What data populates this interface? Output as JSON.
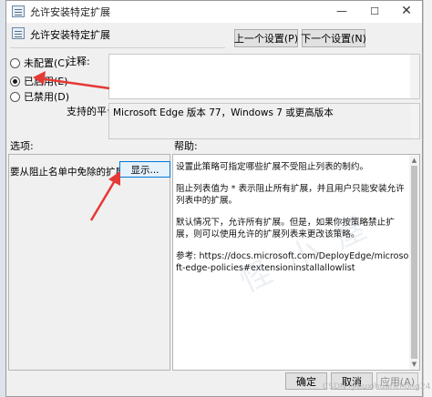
{
  "window": {
    "title": "允许安装特定扩展",
    "minimize_glyph": "—",
    "maximize_glyph": "☐",
    "close_glyph": "✕"
  },
  "header": {
    "title": "允许安装特定扩展",
    "prev_setting": "上一个设置(P)",
    "next_setting": "下一个设置(N)"
  },
  "state": {
    "options": [
      {
        "label": "未配置(C)",
        "checked": false
      },
      {
        "label": "已启用(E)",
        "checked": true
      },
      {
        "label": "已禁用(D)",
        "checked": false
      }
    ]
  },
  "fields": {
    "comment_label": "注释:",
    "comment_value": "",
    "supported_label": "支持的平台:",
    "supported_value": "Microsoft Edge 版本 77，Windows 7 或更高版本"
  },
  "sections": {
    "options_label": "选项:",
    "help_label": "帮助:"
  },
  "options_panel": {
    "exempt_label": "要从阻止名单中免除的扩展 ID",
    "show_button": "显示..."
  },
  "help": {
    "paragraphs": [
      "设置此策略可指定哪些扩展不受阻止列表的制约。",
      "阻止列表值为 * 表示阻止所有扩展，并且用户只能安装允许列表中的扩展。",
      "默认情况下，允许所有扩展。但是，如果你按策略禁止扩展，则可以使用允许的扩展列表来更改该策略。",
      "参考: https://docs.microsoft.com/DeployEdge/microsoft-edge-policies#extensioninstallallowlist"
    ]
  },
  "footer": {
    "ok": "确定",
    "cancel": "取消",
    "apply": "应用(A)"
  },
  "watermark": {
    "text": "怪 小 屋",
    "credit": "CSDN @buxihuanchong24"
  },
  "colors": {
    "accent": "#0078d7",
    "annotation": "#e53935",
    "dialog_bg": "#f0f0f0"
  }
}
